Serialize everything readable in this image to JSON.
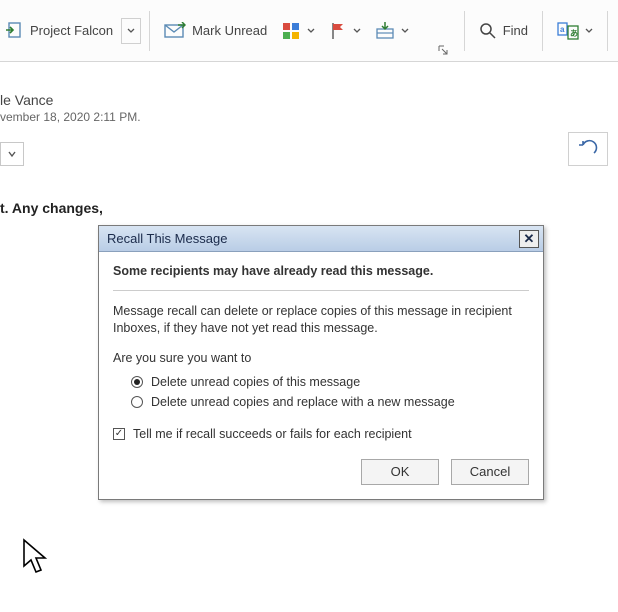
{
  "ribbon": {
    "project_label": "Project Falcon",
    "mark_unread_label": "Mark Unread",
    "find_label": "Find"
  },
  "message": {
    "from_fragment": "le Vance",
    "sent_fragment": "vember 18, 2020 2:11 PM.",
    "body_fragment": "t. Any changes,"
  },
  "dialog": {
    "title": "Recall This Message",
    "warning": "Some recipients may have already read this message.",
    "explanation": "Message recall can delete or replace copies of this message in recipient Inboxes, if they have not yet read this message.",
    "prompt": "Are you sure you want to",
    "option_delete": "Delete unread copies of this message",
    "option_replace": "Delete unread copies and replace with a new message",
    "checkbox_tell": "Tell me if recall succeeds or fails for each recipient",
    "ok": "OK",
    "cancel": "Cancel"
  }
}
